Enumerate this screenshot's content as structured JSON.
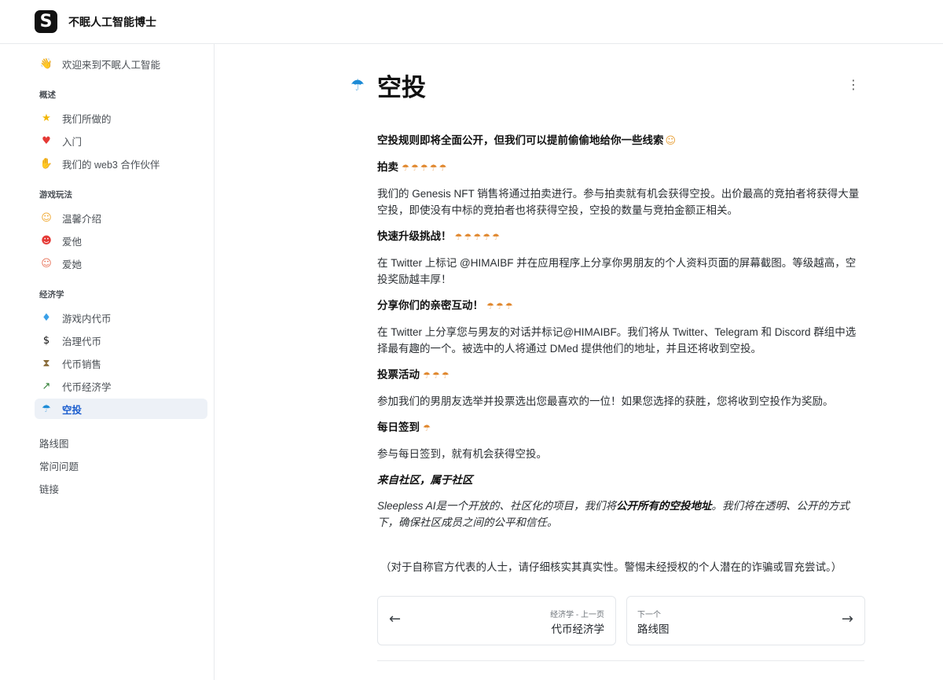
{
  "header": {
    "logo_letter": "S",
    "site_title": "不眠人工智能博士"
  },
  "sidebar": {
    "welcome": {
      "icon": "waving-hand-icon",
      "glyph": "👋",
      "label": "欢迎来到不眠人工智能"
    },
    "sections": [
      {
        "title": "概述",
        "items": [
          {
            "name": "what-we-do",
            "icon": "star-icon",
            "glyph": "★",
            "color": "#f2b600",
            "label": "我们所做的"
          },
          {
            "name": "intro",
            "icon": "heart-icon",
            "glyph": "♥",
            "color": "#e53935",
            "label": "入门"
          },
          {
            "name": "partners",
            "icon": "handshake-icon",
            "glyph": "✋",
            "color": "#f0a830",
            "label": "我们的 web3 合作伙伴"
          }
        ]
      },
      {
        "title": "游戏玩法",
        "items": [
          {
            "name": "warm-intro",
            "icon": "smiling-face-icon",
            "glyph": "☺",
            "color": "#f0a830",
            "label": "温馨介绍"
          },
          {
            "name": "love-him",
            "icon": "heart-eyes-icon",
            "glyph": "☻",
            "color": "#e53935",
            "label": "爱他"
          },
          {
            "name": "love-her",
            "icon": "kissing-face-icon",
            "glyph": "☺",
            "color": "#e8735a",
            "label": "爱她"
          }
        ]
      },
      {
        "title": "经济学",
        "items": [
          {
            "name": "in-game-token",
            "icon": "gem-icon",
            "glyph": "♦",
            "color": "#3aa0e8",
            "label": "游戏内代币"
          },
          {
            "name": "governance-token",
            "icon": "dollar-icon",
            "glyph": "$",
            "color": "#111111",
            "label": "治理代币"
          },
          {
            "name": "token-sale",
            "icon": "hourglass-icon",
            "glyph": "⧗",
            "color": "#8a6d3b",
            "label": "代币销售"
          },
          {
            "name": "tokenomics",
            "icon": "chart-up-icon",
            "glyph": "↗",
            "color": "#2e7d32",
            "label": "代币经济学"
          },
          {
            "name": "airdrop",
            "icon": "parachute-icon",
            "glyph": "☂",
            "color": "#1d8bd6",
            "label": "空投",
            "active": true
          }
        ]
      }
    ],
    "bottom_links": [
      "路线图",
      "常问问题",
      "链接"
    ]
  },
  "page": {
    "icon": "parachute-icon",
    "title": "空投",
    "intro": "空投规则即将全面公开，但我们可以提前偷偷地给你一些线索",
    "sections": [
      {
        "heading": "拍卖",
        "emoji_count": 5,
        "body": "我们的 Genesis NFT 销售将通过拍卖进行。参与拍卖就有机会获得空投。出价最高的竞拍者将获得大量空投，即使没有中标的竞拍者也将获得空投，空投的数量与竞拍金额正相关。"
      },
      {
        "heading": "快速升级挑战！",
        "emoji_count": 5,
        "body": "在 Twitter 上标记 @HIMAIBF 并在应用程序上分享你男朋友的个人资料页面的屏幕截图。等级越高，空投奖励越丰厚！"
      },
      {
        "heading": "分享你们的亲密互动！",
        "emoji_count": 3,
        "body": "在 Twitter 上分享您与男友的对话并标记@HIMAIBF。我们将从 Twitter、Telegram 和 Discord 群组中选择最有趣的一个。被选中的人将通过 DMed 提供他们的地址，并且还将收到空投。"
      },
      {
        "heading": "投票活动",
        "emoji_count": 3,
        "body": "参加我们的男朋友选举并投票选出您最喜欢的一位！如果您选择的获胜，您将收到空投作为奖励。"
      },
      {
        "heading": "每日签到",
        "emoji_count": 1,
        "body": "参与每日签到，就有机会获得空投。"
      }
    ],
    "community": {
      "heading": "来自社区，属于社区",
      "before": "Sleepless AI是一个开放的、社区化的项目，我们将",
      "bold": "公开所有的空投地址",
      "after": "。我们将在透明、公开的方式下，确保社区成员之间的公平和信任。"
    },
    "disclaimer": "（对于自称官方代表的人士，请仔细核实其真实性。警惕未经授权的个人潜在的诈骗或冒充尝试。）"
  },
  "pagination": {
    "prev": {
      "sub": "经济学 - 上一页",
      "title": "代币经济学"
    },
    "next": {
      "sub": "下一个",
      "title": "路线图"
    }
  }
}
